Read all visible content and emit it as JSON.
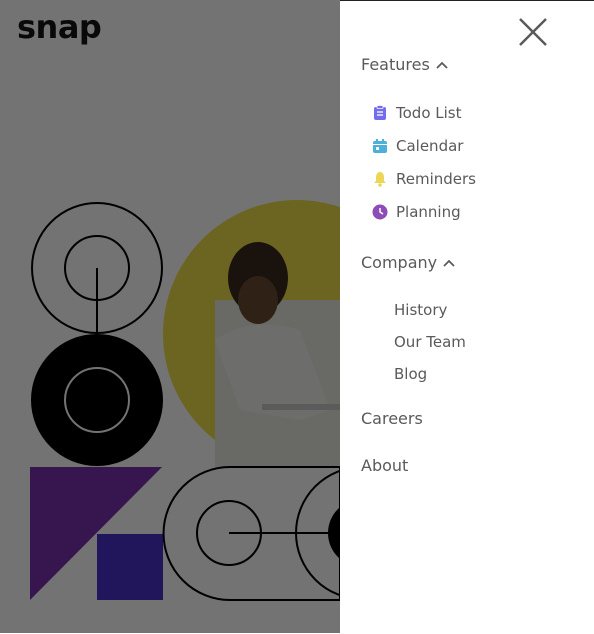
{
  "header": {
    "logo_text": "snap"
  },
  "drawer": {
    "features": {
      "label": "Features",
      "items": [
        {
          "label": "Todo List",
          "icon": "todo-icon",
          "color": "#726CEE"
        },
        {
          "label": "Calendar",
          "icon": "calendar-icon",
          "color": "#4BB1DA"
        },
        {
          "label": "Reminders",
          "icon": "bell-icon",
          "color": "#EDD556"
        },
        {
          "label": "Planning",
          "icon": "clock-icon",
          "color": "#8E4CB6"
        }
      ]
    },
    "company": {
      "label": "Company",
      "items": [
        {
          "label": "History"
        },
        {
          "label": "Our Team"
        },
        {
          "label": "Blog"
        }
      ]
    },
    "careers_label": "Careers",
    "about_label": "About"
  },
  "colors": {
    "overlay": "rgba(0,0,0,0.55)",
    "text": "#5a5a5a",
    "logo": "#141414",
    "hero_circle": "#F0E14A",
    "triangle": "#7B2FB0",
    "square": "#4A2FC9"
  }
}
